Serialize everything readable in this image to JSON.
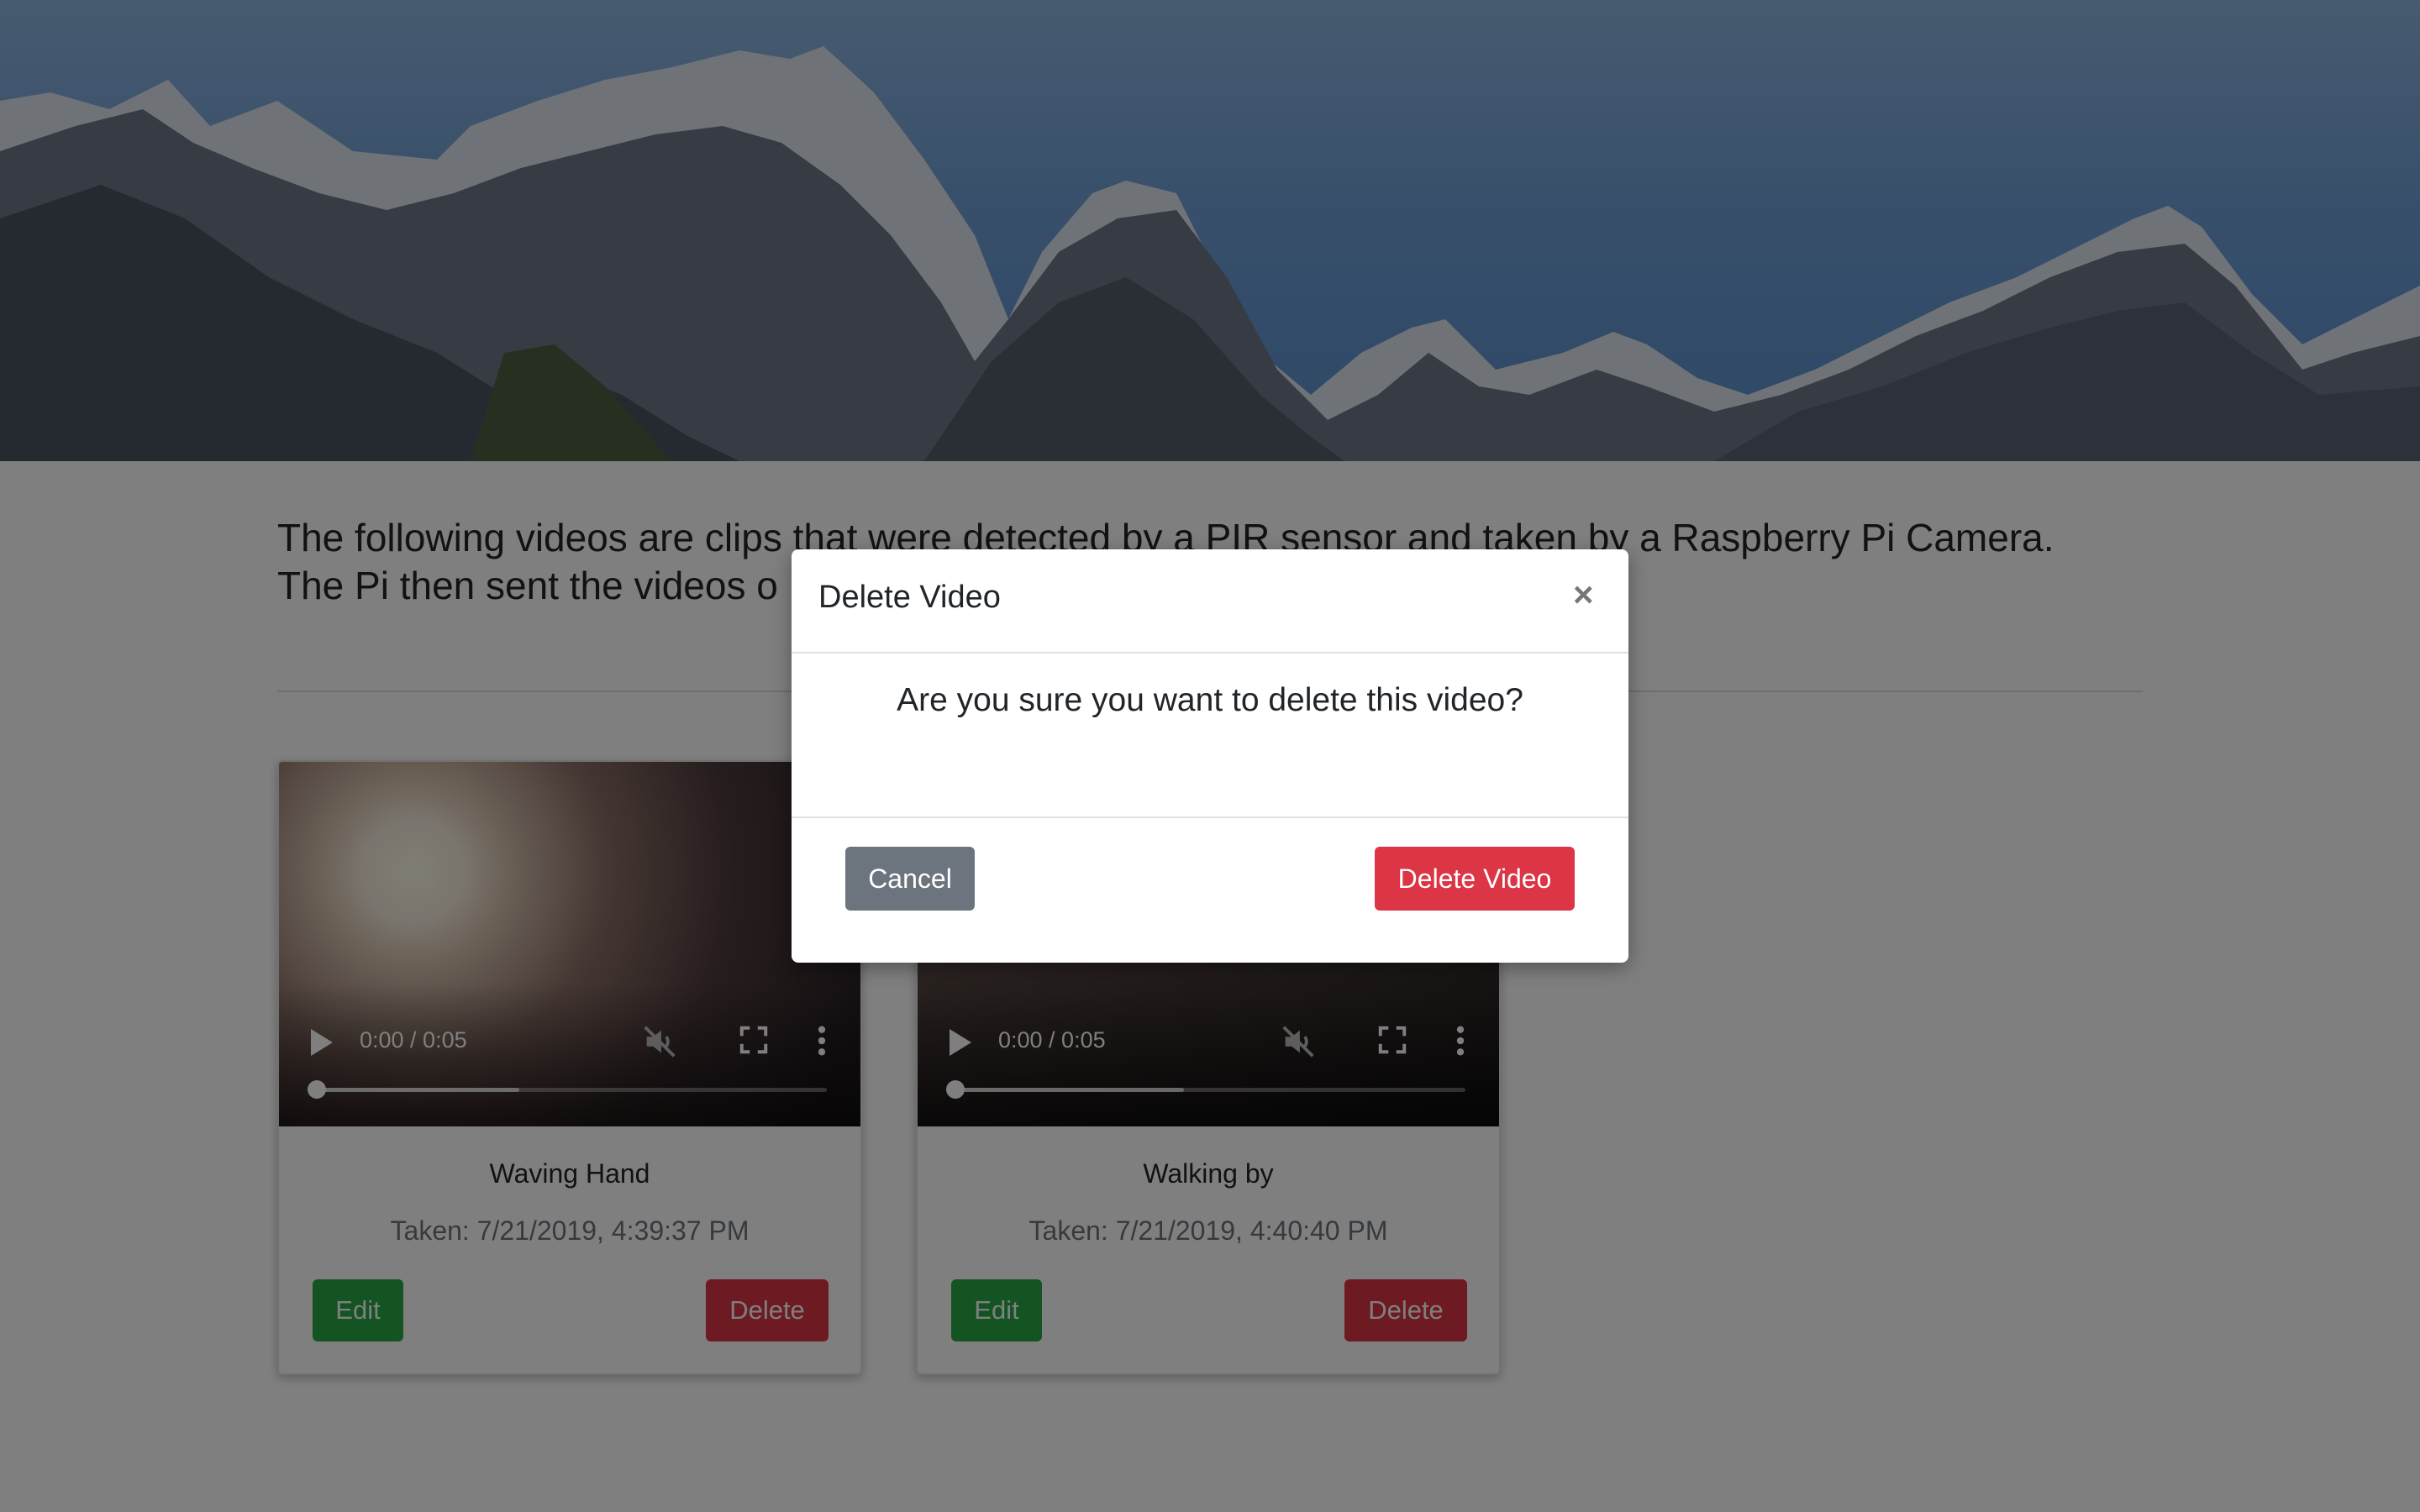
{
  "intro": {
    "line1": "The following videos are clips that were detected by a PIR sensor and taken by a Raspberry Pi Camera.",
    "line2": "The Pi then sent the videos o"
  },
  "videos": [
    {
      "title": "Waving Hand",
      "taken": "Taken: 7/21/2019, 4:39:37 PM",
      "time": "0:00 / 0:05",
      "progress": 0,
      "buffered": 0.4,
      "edit_label": "Edit",
      "delete_label": "Delete"
    },
    {
      "title": "Walking by",
      "taken": "Taken: 7/21/2019, 4:40:40 PM",
      "time": "0:00 / 0:05",
      "progress": 0,
      "buffered": 0.45,
      "edit_label": "Edit",
      "delete_label": "Delete"
    }
  ],
  "modal": {
    "title": "Delete Video",
    "close_glyph": "×",
    "message": "Are you sure you want to delete this video?",
    "cancel_label": "Cancel",
    "confirm_label": "Delete Video"
  },
  "colors": {
    "edit": "#28a745",
    "delete": "#dc3545",
    "cancel": "#6c757d",
    "backdrop": "rgba(0,0,0,0.5)"
  },
  "icons": [
    "play-icon",
    "mute-icon",
    "fullscreen-icon",
    "more-options-icon",
    "close-icon"
  ]
}
